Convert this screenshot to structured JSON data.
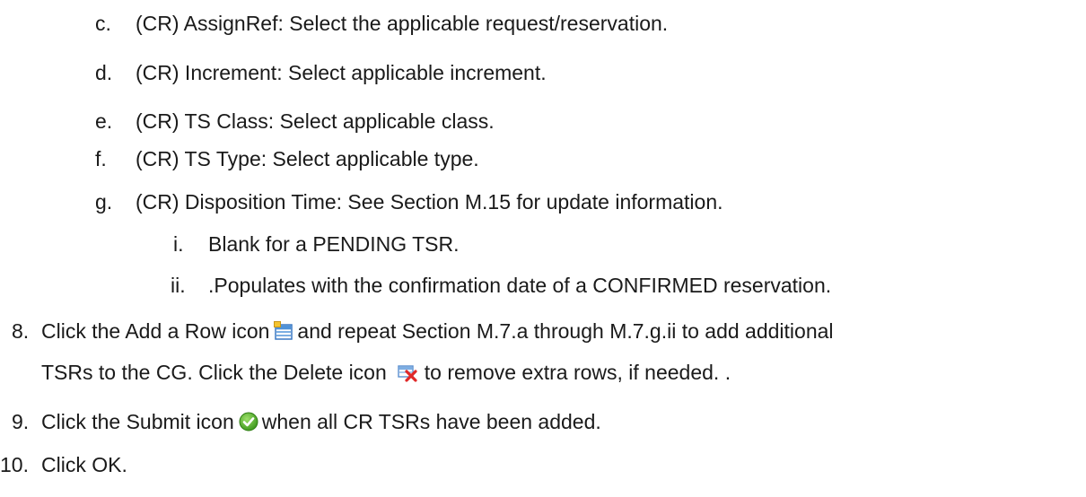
{
  "doc": {
    "sub_items": [
      {
        "marker": "c.",
        "text": "(CR) AssignRef:  Select the applicable request/reservation."
      },
      {
        "marker": "d.",
        "text": "(CR) Increment:  Select applicable increment."
      },
      {
        "marker": "e.",
        "text": "(CR) TS Class:  Select applicable class."
      },
      {
        "marker": "f.",
        "text": "(CR) TS Type:  Select applicable type."
      },
      {
        "marker": "g.",
        "text": "(CR) Disposition Time:  See Section M.15 for update information."
      }
    ],
    "roman_items": [
      {
        "marker": "i.",
        "text": "Blank for a PENDING TSR."
      },
      {
        "marker": "ii.",
        "text": ".Populates with the confirmation date of a CONFIRMED reservation."
      }
    ],
    "step8": {
      "marker": "8.",
      "text_a": "Click the Add a Row icon",
      "text_b": "and repeat Section M.7.a through M.7.g.ii to add additional",
      "text_c": "TSRs to the CG.  Click the Delete icon",
      "text_d": "to remove extra rows, if needed.  ."
    },
    "step9": {
      "marker": "9.",
      "text_a": "Click the Submit icon",
      "text_b": "when all CR TSRs have been added."
    },
    "step10": {
      "marker": "10.",
      "text": "Click OK."
    },
    "icons": {
      "add_row": "add-row-icon",
      "delete_row": "delete-row-icon",
      "submit": "submit-icon"
    }
  }
}
